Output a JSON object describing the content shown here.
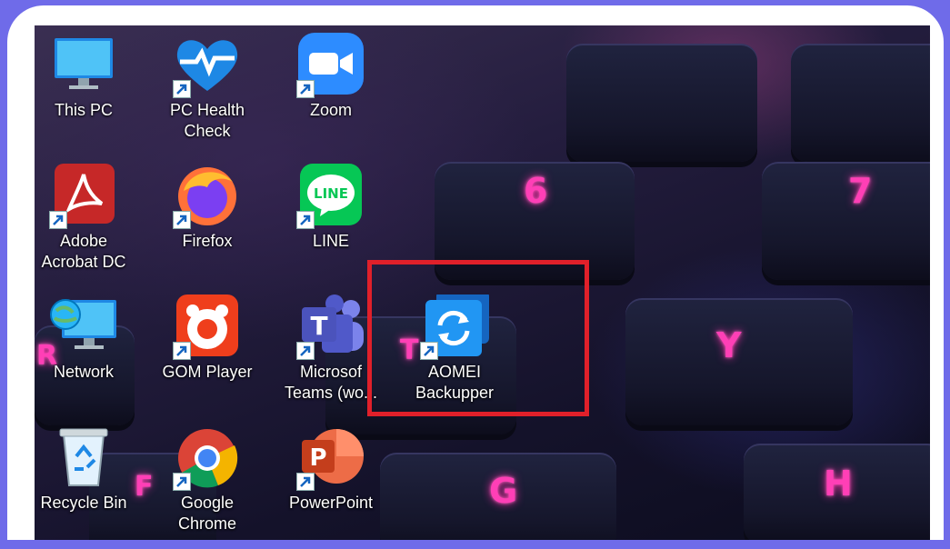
{
  "desktop": {
    "icons": [
      {
        "label": "This PC",
        "icon": "monitor-icon"
      },
      {
        "label": "PC Health\nCheck",
        "icon": "heart-pulse-icon"
      },
      {
        "label": "Zoom",
        "icon": "video-camera-icon"
      },
      {
        "label": "Adobe\nAcrobat DC",
        "icon": "acrobat-icon"
      },
      {
        "label": "Firefox",
        "icon": "firefox-icon"
      },
      {
        "label": "LINE",
        "icon": "line-chat-icon"
      },
      {
        "label": "Network",
        "icon": "network-globe-icon"
      },
      {
        "label": "GOM Player",
        "icon": "gom-player-icon"
      },
      {
        "label": "Microsof\nTeams (wo...",
        "icon": "teams-icon"
      },
      {
        "label": "AOMEI\nBackupper",
        "icon": "aomei-sync-icon"
      },
      {
        "label": "Recycle Bin",
        "icon": "recycle-bin-icon"
      },
      {
        "label": "Google\nChrome",
        "icon": "chrome-icon"
      },
      {
        "label": "PowerPoint",
        "icon": "powerpoint-icon"
      }
    ],
    "wallpaper_keys": [
      "6",
      "7",
      "R",
      "T",
      "Y",
      "F",
      "G",
      "H"
    ]
  },
  "colors": {
    "frame": "#6f6be9",
    "highlight": "#e0202a",
    "key_glow": "#ff3fb6"
  }
}
